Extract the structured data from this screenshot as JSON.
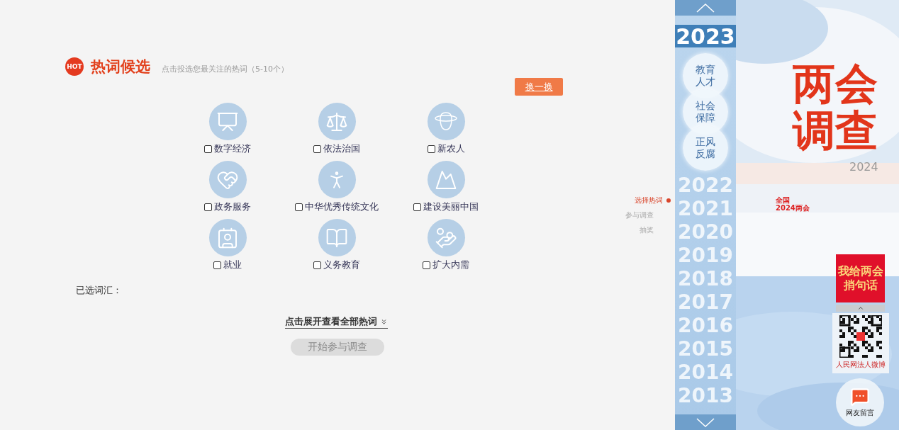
{
  "header": {
    "hot_badge": "HOT",
    "title": "热词候选",
    "hint": "点击投选您最关注的热词（5-10个）"
  },
  "refresh_button": "换一换",
  "keywords": [
    {
      "label": "数字经济",
      "checked": false
    },
    {
      "label": "依法治国",
      "checked": false
    },
    {
      "label": "新农人",
      "checked": false
    },
    {
      "label": "政务服务",
      "checked": false
    },
    {
      "label": "中华优秀传统文化",
      "checked": false
    },
    {
      "label": "建设美丽中国",
      "checked": false
    },
    {
      "label": "就业",
      "checked": false
    },
    {
      "label": "义务教育",
      "checked": false
    },
    {
      "label": "扩大内需",
      "checked": false
    }
  ],
  "selected_label": "已选词汇：",
  "expand_link": "点击展开查看全部热词",
  "start_button": {
    "label": "开始参与调查",
    "disabled": true
  },
  "steps": [
    {
      "label": "选择热词",
      "selected": true
    },
    {
      "label": "参与调查",
      "selected": false
    },
    {
      "label": "抽奖",
      "selected": false
    }
  ],
  "years": [
    {
      "label": "2023",
      "selected": true,
      "topics": [
        "教育人才",
        "社会保障",
        "正风反腐"
      ]
    },
    {
      "label": "2022",
      "selected": false
    },
    {
      "label": "2021",
      "selected": false
    },
    {
      "label": "2020",
      "selected": false
    },
    {
      "label": "2019",
      "selected": false
    },
    {
      "label": "2018",
      "selected": false
    },
    {
      "label": "2017",
      "selected": false
    },
    {
      "label": "2016",
      "selected": false
    },
    {
      "label": "2015",
      "selected": false
    },
    {
      "label": "2014",
      "selected": false
    },
    {
      "label": "2013",
      "selected": false
    }
  ],
  "banner": {
    "title": "两会调查",
    "year": "2024",
    "logo_top": "全国",
    "logo_bottom": "2024两会",
    "promo": "我给两会捎句话",
    "qr_caption": "人民网法人微博",
    "message_button": "网友留言"
  }
}
